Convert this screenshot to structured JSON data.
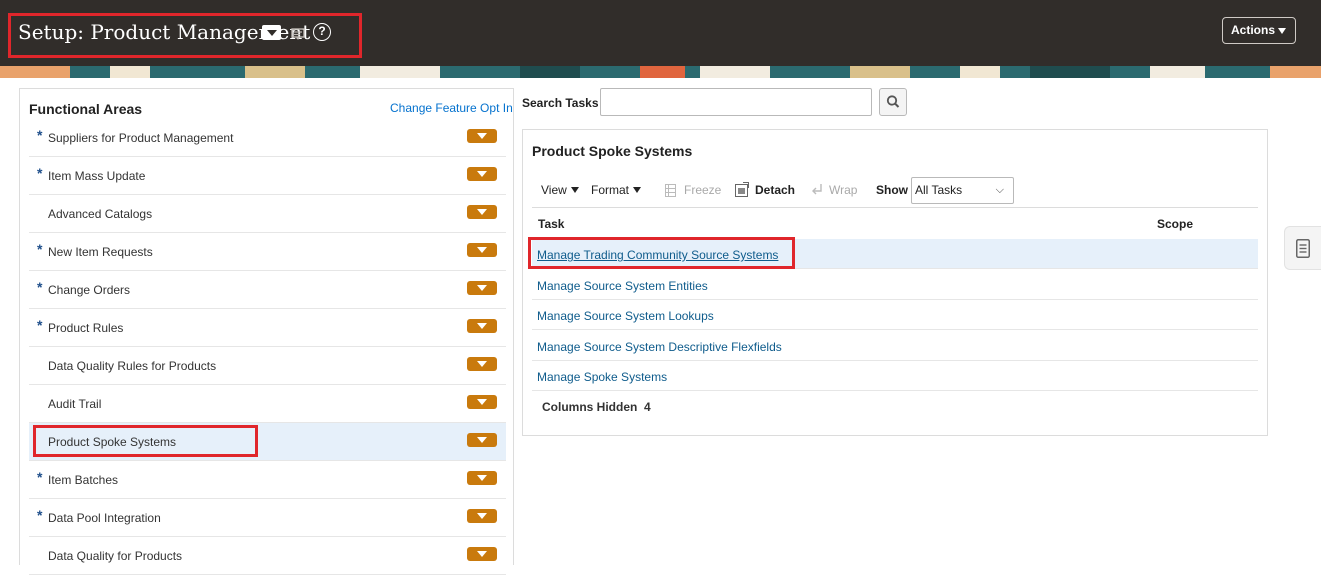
{
  "header": {
    "title": "Setup: Product Management",
    "help_glyph": "?",
    "actions_label": "Actions"
  },
  "functional_areas": {
    "title": "Functional Areas",
    "change_feature_opt_in": "Change Feature Opt In",
    "items": [
      {
        "label": "Suppliers for Product Management",
        "required": true
      },
      {
        "label": "Item Mass Update",
        "required": true
      },
      {
        "label": "Advanced Catalogs",
        "required": false
      },
      {
        "label": "New Item Requests",
        "required": true
      },
      {
        "label": "Change Orders",
        "required": true
      },
      {
        "label": "Product Rules",
        "required": true
      },
      {
        "label": "Data Quality Rules for Products",
        "required": false
      },
      {
        "label": "Audit Trail",
        "required": false
      },
      {
        "label": "Product Spoke Systems",
        "required": false,
        "selected": true
      },
      {
        "label": "Item Batches",
        "required": true
      },
      {
        "label": "Data Pool Integration",
        "required": true
      },
      {
        "label": "Data Quality for Products",
        "required": false
      }
    ],
    "required_mark": "*"
  },
  "search": {
    "label": "Search Tasks",
    "value": "",
    "placeholder": ""
  },
  "tasks_panel": {
    "title": "Product Spoke Systems",
    "toolbar": {
      "view": "View",
      "format": "Format",
      "freeze": "Freeze",
      "detach": "Detach",
      "wrap": "Wrap",
      "show_label": "Show",
      "show_value": "All Tasks"
    },
    "columns": {
      "task": "Task",
      "scope": "Scope"
    },
    "tasks": [
      "Manage Trading Community Source Systems",
      "Manage Source System Entities",
      "Manage Source System Lookups",
      "Manage Source System Descriptive Flexfields",
      "Manage Spoke Systems"
    ],
    "columns_hidden_label": "Columns Hidden",
    "columns_hidden_count": "4"
  },
  "colors": {
    "header_bg": "#312d2a",
    "highlight_red": "#e0262b",
    "dropdown_orange": "#c97a0d",
    "link_blue": "#0f5c8c",
    "selected_row": "#e6f0fa"
  }
}
